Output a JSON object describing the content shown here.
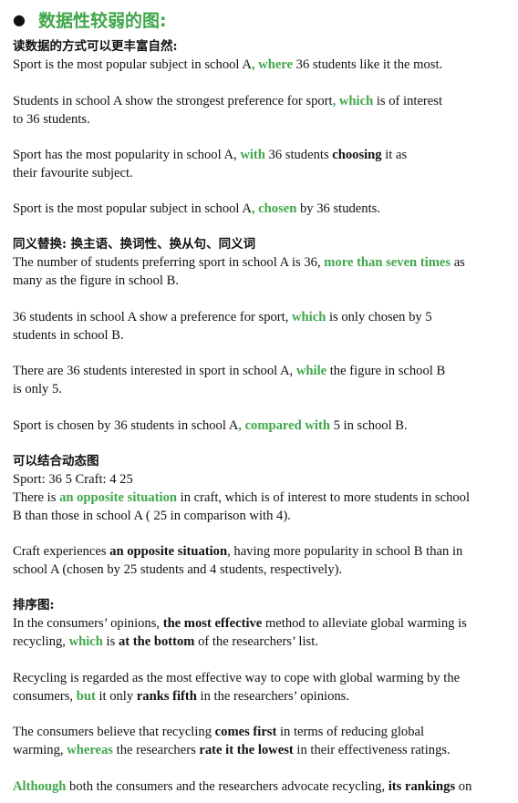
{
  "heading": {
    "bullet": "●",
    "text": "数据性较弱的图:"
  },
  "colors": {
    "accent_green": "#3fa64a",
    "text": "#111111"
  },
  "blocks": [
    {
      "lines": [
        [
          {
            "t": "读数据的方式可以更丰富自然:",
            "s": "cn"
          }
        ],
        [
          {
            "t": "Sport is the most popular subject in school A"
          },
          {
            "t": ", where",
            "s": "g"
          },
          {
            "t": " 36 students like it the most."
          }
        ]
      ]
    },
    {
      "lines": [
        [
          {
            "t": "Students in school A show the strongest preference for sport"
          },
          {
            "t": ", which",
            "s": "g"
          },
          {
            "t": " is of interest"
          }
        ],
        [
          {
            "t": "to 36 students."
          }
        ]
      ]
    },
    {
      "lines": [
        [
          {
            "t": "Sport has the most popularity in school A, "
          },
          {
            "t": "with",
            "s": "g"
          },
          {
            "t": " 36 students "
          },
          {
            "t": "choosing",
            "s": "b"
          },
          {
            "t": " it as"
          }
        ],
        [
          {
            "t": "their favourite subject."
          }
        ]
      ]
    },
    {
      "lines": [
        [
          {
            "t": "Sport is the most popular subject in school A"
          },
          {
            "t": ", chosen",
            "s": "g"
          },
          {
            "t": " by 36 students."
          }
        ]
      ]
    },
    {
      "lines": [
        [
          {
            "t": "同义替换: 换主语、换词性、换从句、同义词",
            "s": "cn"
          }
        ],
        [
          {
            "t": "The number of students preferring sport in school A is 36, "
          },
          {
            "t": "more than seven times",
            "s": "g"
          },
          {
            "t": " as"
          }
        ],
        [
          {
            "t": "many as the figure in school B."
          }
        ]
      ]
    },
    {
      "lines": [
        [
          {
            "t": "36 students in school A show a preference for sport, "
          },
          {
            "t": "which",
            "s": "g"
          },
          {
            "t": " is only chosen by 5"
          }
        ],
        [
          {
            "t": "students in school B."
          }
        ]
      ]
    },
    {
      "lines": [
        [
          {
            "t": "There are 36 students interested in sport in school A, "
          },
          {
            "t": "while",
            "s": "g"
          },
          {
            "t": " the figure in school B"
          }
        ],
        [
          {
            "t": "is only 5."
          }
        ]
      ]
    },
    {
      "lines": [
        [
          {
            "t": "Sport is chosen by 36 students in school A"
          },
          {
            "t": ", compared with",
            "s": "g"
          },
          {
            "t": " 5 in school B."
          }
        ]
      ]
    },
    {
      "lines": [
        [
          {
            "t": "可以结合动态图",
            "s": "cn"
          }
        ],
        [
          {
            "t": "Sport: 36 5      Craft: 4 25"
          }
        ],
        [
          {
            "t": "There is "
          },
          {
            "t": "an opposite situation",
            "s": "g"
          },
          {
            "t": " in craft, which is of interest to more students in school"
          }
        ],
        [
          {
            "t": "B than those in school A ( 25 in comparison with 4)."
          }
        ]
      ]
    },
    {
      "lines": [
        [
          {
            "t": "Craft experiences "
          },
          {
            "t": "an opposite situation",
            "s": "b"
          },
          {
            "t": ", having more popularity in school B than in"
          }
        ],
        [
          {
            "t": "school A (chosen by 25 students and 4 students, respectively)."
          }
        ]
      ]
    },
    {
      "lines": [
        [
          {
            "t": "排序图:",
            "s": "cn"
          }
        ],
        [
          {
            "t": "In the consumers’ opinions, "
          },
          {
            "t": "the most effective",
            "s": "b"
          },
          {
            "t": " method to alleviate global warming is"
          }
        ],
        [
          {
            "t": "recycling, "
          },
          {
            "t": "which",
            "s": "g"
          },
          {
            "t": " is "
          },
          {
            "t": "at the bottom",
            "s": "b"
          },
          {
            "t": " of the researchers’ list."
          }
        ]
      ]
    },
    {
      "lines": [
        [
          {
            "t": "Recycling is regarded as the most effective way to cope with global warming by the"
          }
        ],
        [
          {
            "t": "consumers, "
          },
          {
            "t": "but",
            "s": "g"
          },
          {
            "t": " it only "
          },
          {
            "t": "ranks fifth",
            "s": "b"
          },
          {
            "t": " in the researchers’ opinions."
          }
        ]
      ]
    },
    {
      "lines": [
        [
          {
            "t": "The consumers believe that recycling "
          },
          {
            "t": "comes first",
            "s": "b"
          },
          {
            "t": " in terms of reducing global"
          }
        ],
        [
          {
            "t": "warming, "
          },
          {
            "t": "whereas",
            "s": "g"
          },
          {
            "t": " the researchers "
          },
          {
            "t": "rate it the lowest",
            "s": "b"
          },
          {
            "t": " in their effectiveness ratings."
          }
        ]
      ]
    },
    {
      "lines": [
        [
          {
            "t": "Although",
            "s": "g"
          },
          {
            "t": " both the consumers and the researchers advocate recycling, "
          },
          {
            "t": "its rankings",
            "s": "b"
          },
          {
            "t": " on"
          }
        ]
      ]
    }
  ]
}
